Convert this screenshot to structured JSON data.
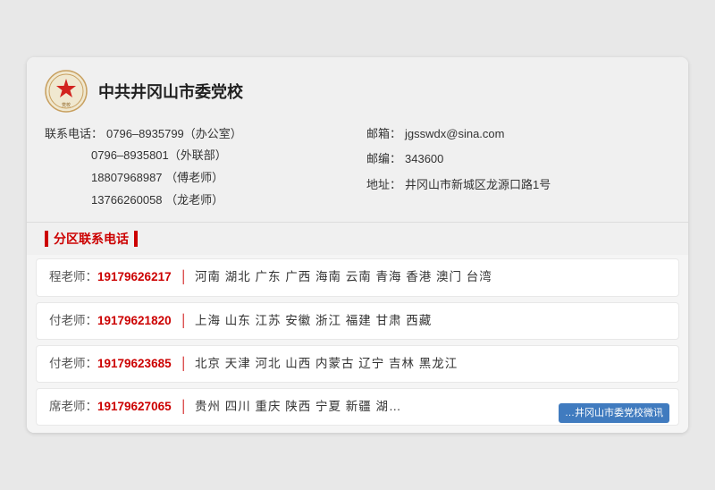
{
  "school": {
    "name": "中共井冈山市委党校",
    "logo_alt": "党校Logo"
  },
  "contact": {
    "phone_label": "联系电话：",
    "phone1": "0796–8935799（办公室）",
    "phone2": "0796–8935801（外联部）",
    "phone3": "18807968987 （傅老师）",
    "phone4": "13766260058 （龙老师）",
    "email_label": "邮箱：",
    "email": "jgsswdx@sina.com",
    "postcode_label": "邮编：",
    "postcode": "343600",
    "address_label": "地址：",
    "address": "井冈山市新城区龙源口路1号"
  },
  "section_title": "分区联系电话",
  "regions": [
    {
      "teacher": "程老师：",
      "phone": "19179626217",
      "separator": "│",
      "areas": "河南  湖北  广东  广西  海南  云南  青海  香港  澳门  台湾"
    },
    {
      "teacher": "付老师：",
      "phone": "19179621820",
      "separator": "│",
      "areas": "上海  山东  江苏  安徽  浙江  福建  甘肃  西藏"
    },
    {
      "teacher": "付老师：",
      "phone": "19179623685",
      "separator": "│",
      "areas": "北京  天津  河北  山西  内蒙古  辽宁  吉林  黑龙江"
    },
    {
      "teacher": "席老师：",
      "phone": "19179627065",
      "separator": "│",
      "areas": "贵州  四川  重庆  陕西  宁夏  新疆  湖…",
      "watermark": "…井冈山市委党校微讯"
    }
  ]
}
